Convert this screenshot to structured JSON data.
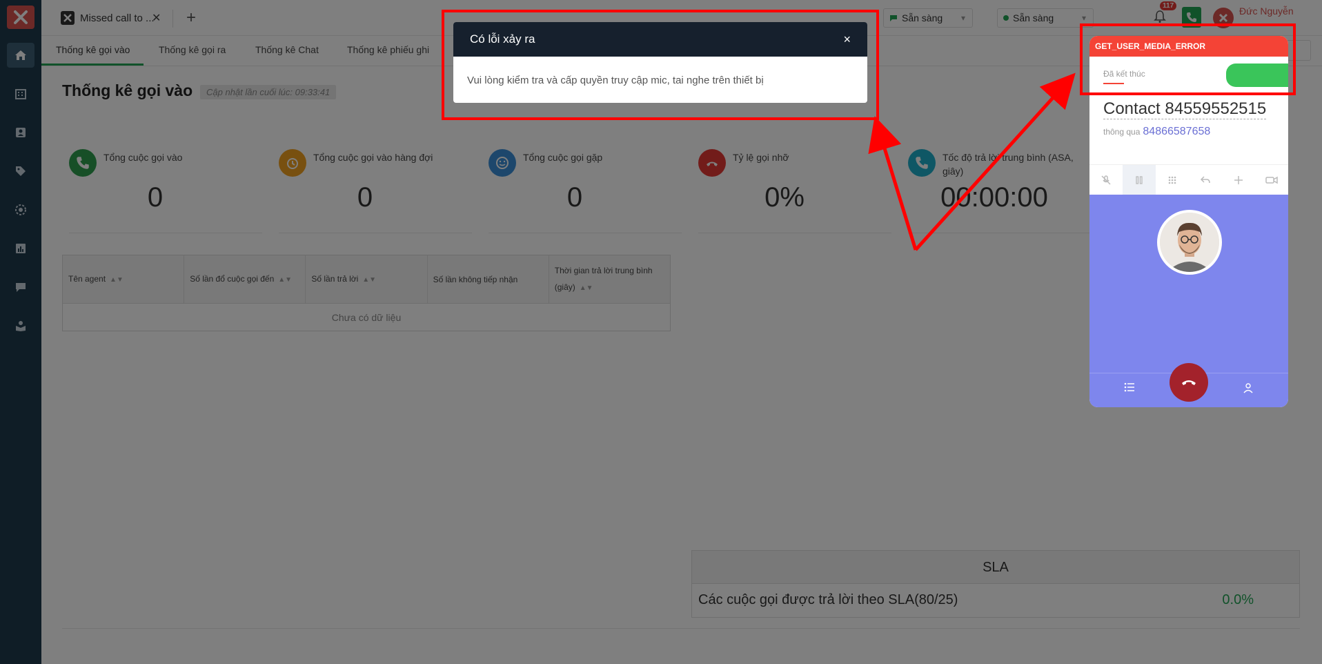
{
  "browser": {
    "tab_title": "Missed call to ...",
    "tab_close": "✕",
    "new_tab": "+"
  },
  "topbar": {
    "status_1": "Sẵn sàng",
    "status_2": "Sẵn sàng",
    "notification_count": "117",
    "user_name": "Đức Nguyễn",
    "status_1_color": "#23a455",
    "status_2_color": "#23a455"
  },
  "subtabs": [
    "Thống kê gọi vào",
    "Thống kê gọi ra",
    "Thống kê Chat",
    "Thống kê phiếu ghi"
  ],
  "page": {
    "title": "Thống kê gọi vào",
    "updated": "Cập nhật lần cuối lúc: 09:33:41"
  },
  "stats": [
    {
      "label": "Tổng cuộc gọi vào",
      "value": "0",
      "color": "#2e9e4f",
      "icon": "phone-icon"
    },
    {
      "label": "Tổng cuộc gọi vào hàng đợi",
      "value": "0",
      "color": "#f0a020",
      "icon": "alarm-clock-icon"
    },
    {
      "label": "Tổng cuộc gọi gặp",
      "value": "0",
      "color": "#3a8fd8",
      "icon": "smile-face-icon"
    },
    {
      "label": "Tỷ lệ gọi nhỡ",
      "value": "0%",
      "color": "#e53935",
      "icon": "missed-call-icon"
    },
    {
      "label": "Tốc độ trả lời trung bình (ASA, giây)",
      "value": "00:00:00",
      "color": "#1faecb",
      "icon": "phone-speed-icon"
    }
  ],
  "table": {
    "columns": [
      "Tên agent",
      "Số lần đổ cuộc gọi đến",
      "Số lần trả lời",
      "Số lần không tiếp nhận",
      "Thời gian trả lời trung bình (giây)"
    ],
    "empty": "Chưa có dữ liệu"
  },
  "sla": {
    "header": "SLA",
    "row_label": "Các cuộc gọi được trả lời theo SLA(80/25)",
    "row_value": "0.0%"
  },
  "modal": {
    "title": "Có lỗi xảy ra",
    "close": "×",
    "message": "Vui lòng kiểm tra và cấp quyền truy cập mic, tai nghe trên thiết bị"
  },
  "softphone": {
    "error": "GET_USER_MEDIA_ERROR",
    "status": "Đã kết thúc",
    "contact": "Contact 84559552515",
    "via_label": "thông qua",
    "via_number": "84866587658"
  }
}
